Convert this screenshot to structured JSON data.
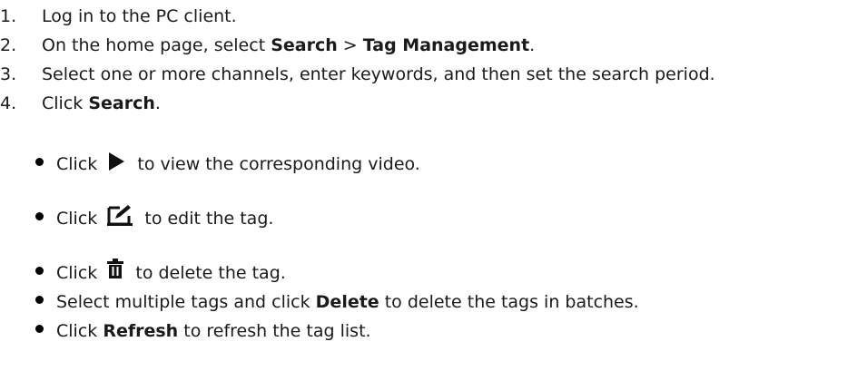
{
  "steps": [
    {
      "num": "1.",
      "pre": "Log in to the PC client.",
      "b1": "",
      "mid": "",
      "b2": "",
      "post": ""
    },
    {
      "num": "2.",
      "pre": "On the home page, select ",
      "b1": "Search",
      "mid": " > ",
      "b2": "Tag Management",
      "post": "."
    },
    {
      "num": "3.",
      "pre": "Select one or more channels, enter keywords, and then set the search period.",
      "b1": "",
      "mid": "",
      "b2": "",
      "post": ""
    },
    {
      "num": "4.",
      "pre": "Click ",
      "b1": "Search",
      "mid": "",
      "b2": "",
      "post": "."
    }
  ],
  "bullets": {
    "play": {
      "pre": "Click ",
      "post": " to view the corresponding video.",
      "icon": "play-icon"
    },
    "edit": {
      "pre": "Click ",
      "post": " to edit the tag.",
      "icon": "edit-icon"
    },
    "delete": {
      "pre": "Click ",
      "post": " to delete the tag.",
      "icon": "trash-icon"
    },
    "batch": {
      "pre": "Select multiple tags and click ",
      "bold": "Delete",
      "post": " to delete the tags in batches."
    },
    "refresh": {
      "pre": "Click ",
      "bold": "Refresh",
      "post": " to refresh the tag list."
    }
  }
}
